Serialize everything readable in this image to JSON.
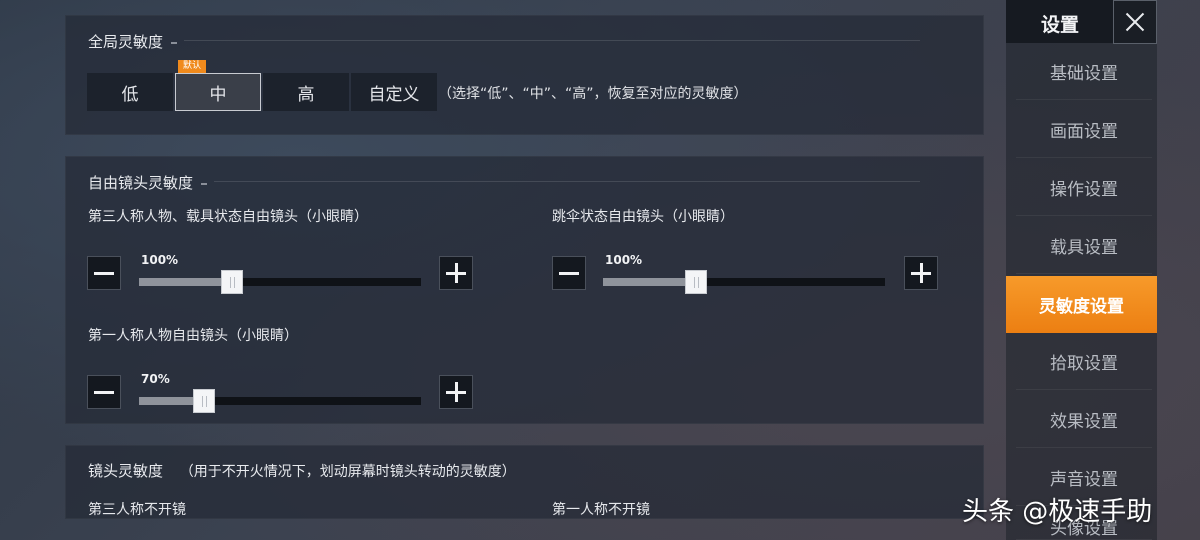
{
  "global_sensitivity": {
    "title": "全局灵敏度",
    "presets": [
      {
        "label": "低",
        "selected": false
      },
      {
        "label": "中",
        "selected": true,
        "badge": "默认"
      },
      {
        "label": "高",
        "selected": false
      },
      {
        "label": "自定义",
        "selected": false
      }
    ],
    "hint": "（选择“低”、“中”、“高”，恢复至对应的灵敏度）"
  },
  "free_look": {
    "title": "自由镜头灵敏度",
    "sliders": [
      {
        "label": "第三人称人物、载具状态自由镜头（小眼睛）",
        "value_text": "100%",
        "fraction": 0.33
      },
      {
        "label": "跳伞状态自由镜头（小眼睛）",
        "value_text": "100%",
        "fraction": 0.33
      },
      {
        "label": "第一人称人物自由镜头（小眼睛）",
        "value_text": "70%",
        "fraction": 0.23
      }
    ]
  },
  "camera_sensitivity": {
    "title": "镜头灵敏度",
    "subtitle": "（用于不开火情况下，划动屏幕时镜头转动的灵敏度）",
    "col1": "第三人称不开镜",
    "col2": "第一人称不开镜"
  },
  "sidebar": {
    "title": "设置",
    "items": [
      {
        "label": "基础设置"
      },
      {
        "label": "画面设置"
      },
      {
        "label": "操作设置"
      },
      {
        "label": "载具设置"
      },
      {
        "label": "灵敏度设置",
        "active": true
      },
      {
        "label": "拾取设置"
      },
      {
        "label": "效果设置"
      },
      {
        "label": "声音设置"
      },
      {
        "label": "头像设置"
      }
    ]
  },
  "watermark": "头条 @极速手助",
  "colors": {
    "accent": "#f08a1c",
    "panel": "#242a36"
  }
}
